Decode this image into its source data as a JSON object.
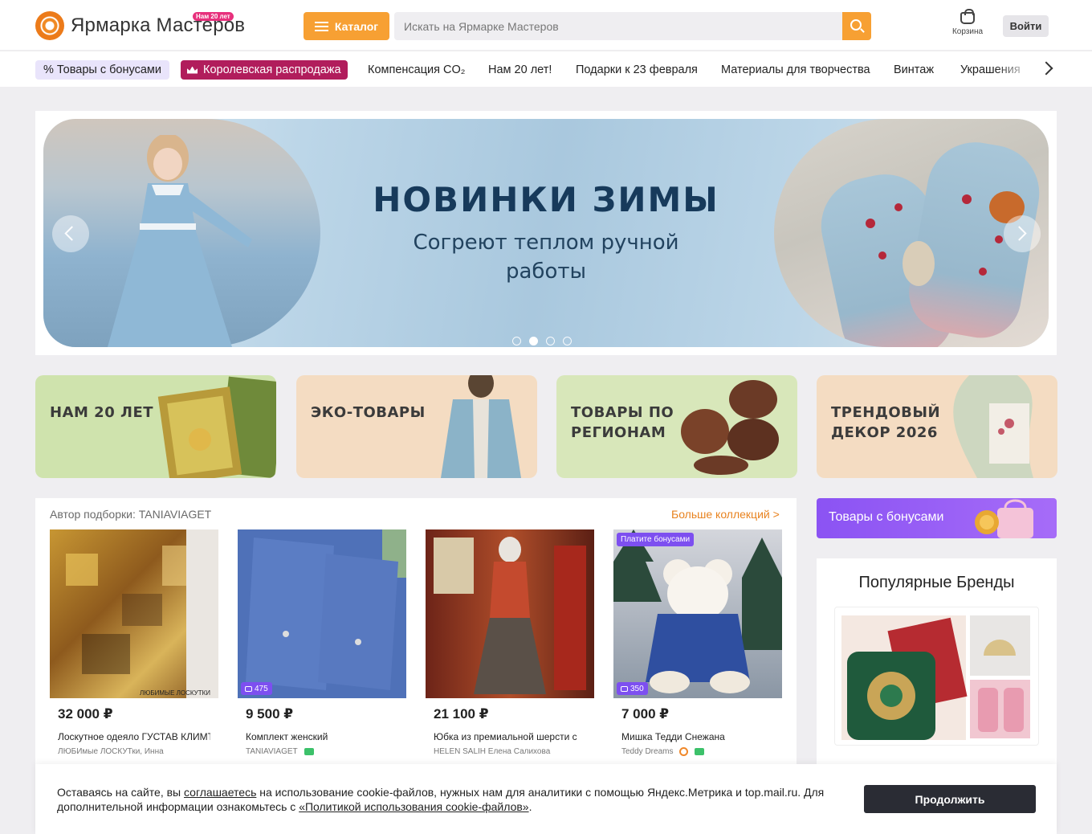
{
  "header": {
    "logo_text": "Ярмарка Мастеров",
    "logo_badge": "Нам 20 лет",
    "catalog_label": "Каталог",
    "search_placeholder": "Искать на Ярмарке Мастеров",
    "cart_label": "Корзина",
    "login_label": "Войти"
  },
  "nav": {
    "items": [
      "% Товары с бонусами",
      "Королевская распродажа",
      "Компенсация CO₂",
      "Нам 20 лет!",
      "Подарки к 23 февраля",
      "Материалы для творчества",
      "Винтаж",
      "Украшения"
    ]
  },
  "banner": {
    "title": "НОВИНКИ ЗИМЫ",
    "subtitle": "Согреют теплом ручной работы",
    "slide_count": 4,
    "active_slide": 2
  },
  "tiles": [
    {
      "label": "НАМ 20 ЛЕТ"
    },
    {
      "label": "ЭКО-ТОВАРЫ"
    },
    {
      "label": "ТОВАРЫ ПО РЕГИОНАМ"
    },
    {
      "label": "ТРЕНДОВЫЙ ДЕКОР 2026"
    }
  ],
  "collection": {
    "author": "Автор подборки: TANIAVIAGET",
    "more_link": "Больше коллекций >",
    "cards": [
      {
        "price": "32 000 ₽",
        "title": "Лоскутное одеяло ГУСТАВ КЛИМТ",
        "seller": "ЛЮБИмые ЛОСКУТки, Инна",
        "bonus": "",
        "pay_bonus": "",
        "watermark": "ЛЮБИМЫЕ ЛОСКУТКИ"
      },
      {
        "price": "9 500 ₽",
        "title": "Комплект женский",
        "seller": "TANIAVIAGET",
        "bonus": "475",
        "pay_bonus": ""
      },
      {
        "price": "21 100 ₽",
        "title": "Юбка из премиальной шерсти с",
        "seller": "HELEN SALIH Елена Салихова",
        "bonus": "",
        "pay_bonus": ""
      },
      {
        "price": "7 000 ₽",
        "title": "Мишка Тедди Снежана",
        "seller": "Teddy Dreams",
        "bonus": "350",
        "pay_bonus": "Платите бонусами"
      }
    ]
  },
  "sidebar": {
    "bonus_banner": "Товары с бонусами",
    "brands_title": "Популярные Бренды"
  },
  "cookie": {
    "text_1": "Оставаясь на сайте, вы ",
    "link_1": "соглашаетесь",
    "text_2": " на использование cookie-файлов, нужных нам для аналитики с помощью Яндекс.Метрика и top.mail.ru. Для дополнительной информации ознакомьтесь с ",
    "link_2": "«Политикой использования cookie-файлов»",
    "text_3": ".",
    "button": "Продолжить"
  },
  "colors": {
    "accent_orange": "#f7a033",
    "royal_sale": "#b11d5c",
    "bonus_purple": "#7d4ff0",
    "link_orange": "#e8821e"
  }
}
